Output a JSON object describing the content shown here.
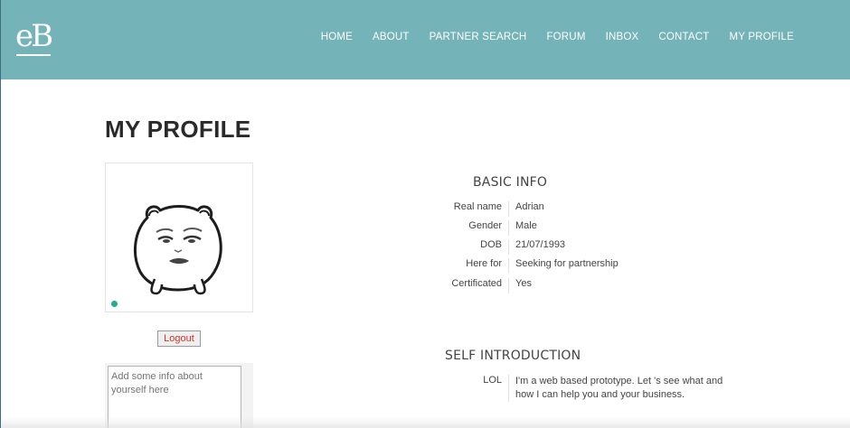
{
  "header": {
    "logo_text": "eB",
    "nav": [
      "HOME",
      "ABOUT",
      "PARTNER SEARCH",
      "FORUM",
      "INBOX",
      "CONTACT",
      "MY PROFILE"
    ]
  },
  "page": {
    "title": "MY PROFILE"
  },
  "profile": {
    "logout_label": "Logout",
    "intro_placeholder": "Add some info about yourself here"
  },
  "basic_info": {
    "title": "BASIC INFO",
    "rows": [
      {
        "label": "Real name",
        "value": "Adrian"
      },
      {
        "label": "Gender",
        "value": "Male"
      },
      {
        "label": "DOB",
        "value": "21/07/1993"
      },
      {
        "label": "Here for",
        "value": "Seeking for partnership"
      },
      {
        "label": "Certificated",
        "value": "Yes"
      }
    ]
  },
  "self_intro": {
    "title": "SELF INTRODUCTION",
    "label": "LOL",
    "text": "I'm a web based prototype. Let 's see what and how I can help you and your business."
  },
  "colors": {
    "header_bg": "#74b3b8",
    "online": "#1fae8e",
    "logout_text": "#d0342c"
  },
  "icons": [
    "logo",
    "avatar-cartoon",
    "online-status-dot"
  ]
}
